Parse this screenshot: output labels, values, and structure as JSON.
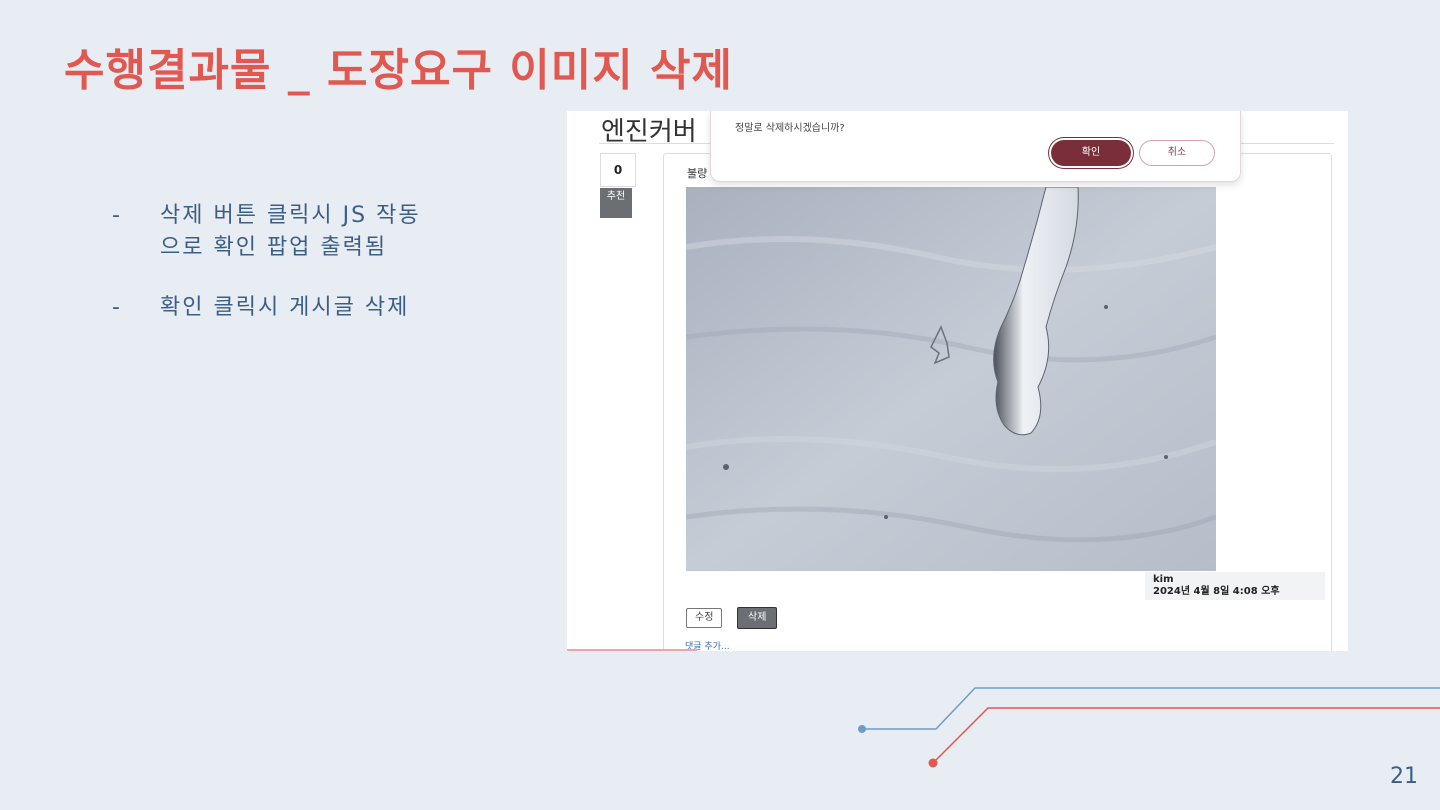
{
  "slide": {
    "title": "수행결과물 _ 도장요구 이미지 삭제",
    "page_number": "21",
    "bullets": [
      {
        "dash": "-",
        "text": "삭제 버튼 클릭시 JS 작동으로 확인 팝업 출력됨"
      },
      {
        "dash": "-",
        "text": "확인 클릭시 게시글 삭제"
      }
    ]
  },
  "screenshot": {
    "post_title": "엔진커버",
    "vote_count": "0",
    "vote_button": "추천",
    "card_label": "불량",
    "author": "kim",
    "date": "2024년 4월 8일 4:08 오후",
    "edit_button": "수정",
    "delete_button": "삭제",
    "comment_link": "댓글 추가...",
    "dialog": {
      "message": "정말로 삭제하시겠습니까?",
      "confirm": "확인",
      "cancel": "취소"
    }
  },
  "colors": {
    "title": "#e0584f",
    "body_text": "#3b5e85",
    "background": "#e8edf3",
    "confirm_button": "#7a2e3a"
  }
}
